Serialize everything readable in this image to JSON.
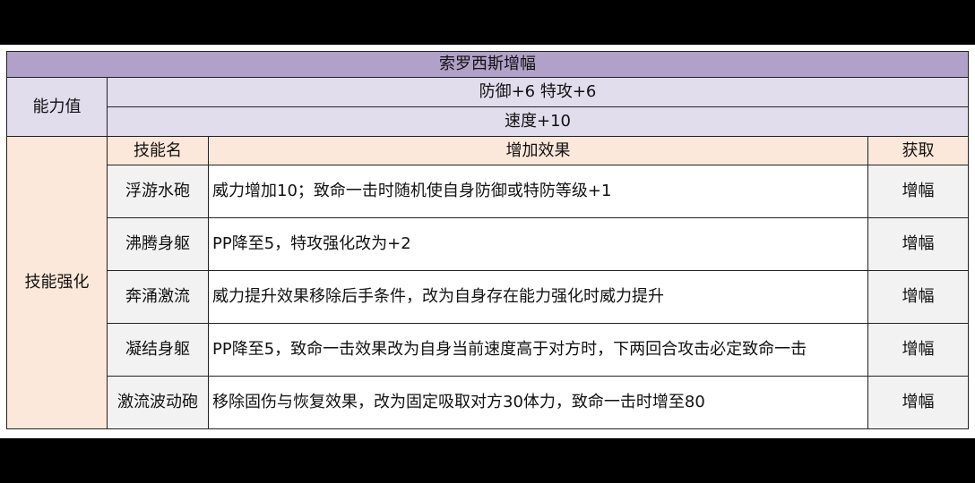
{
  "table": {
    "title": "索罗西斯增幅",
    "stats": {
      "label": "能力值",
      "lines": [
        "防御+6 特攻+6",
        "速度+10"
      ]
    },
    "skills": {
      "label": "技能强化",
      "headers": [
        "技能名",
        "增加效果",
        "获取"
      ],
      "rows": [
        {
          "name": "浮游水砲",
          "effect": "威力增加10；致命一击时随机使自身防御或特防等级+1",
          "source": "增幅"
        },
        {
          "name": "沸腾身躯",
          "effect": "PP降至5，特攻强化改为+2",
          "source": "增幅"
        },
        {
          "name": "奔涌激流",
          "effect": "威力提升效果移除后手条件，改为自身存在能力强化时威力提升",
          "source": "增幅"
        },
        {
          "name": "凝结身躯",
          "effect": "PP降至5，致命一击效果改为自身当前速度高于对方时，下两回合攻击必定致命一击",
          "source": "增幅"
        },
        {
          "name": "激流波动砲",
          "effect": "移除固伤与恢复效果，改为固定吸取对方30体力，致命一击时增至80",
          "source": "增幅"
        }
      ]
    }
  }
}
